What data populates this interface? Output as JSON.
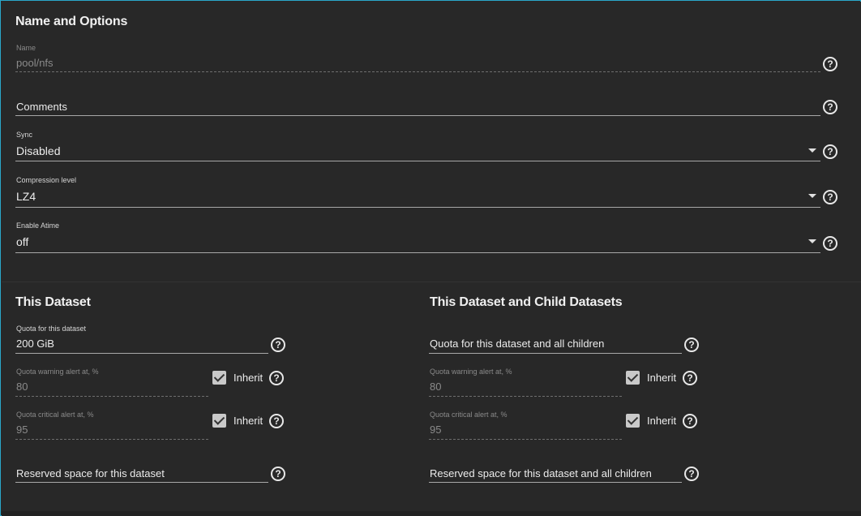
{
  "name_options": {
    "heading": "Name and Options",
    "name": {
      "label": "Name",
      "value": "pool/nfs"
    },
    "comments": {
      "placeholder": "Comments"
    },
    "sync": {
      "label": "Sync",
      "value": "Disabled"
    },
    "compression": {
      "label": "Compression level",
      "value": "LZ4"
    },
    "atime": {
      "label": "Enable Atime",
      "value": "off"
    }
  },
  "this_dataset": {
    "heading": "This Dataset",
    "quota": {
      "label": "Quota for this dataset",
      "value": "200 GiB"
    },
    "warning": {
      "label": "Quota warning alert at, %",
      "value": "80",
      "inherit_label": "Inherit",
      "inherit_checked": true
    },
    "critical": {
      "label": "Quota critical alert at, %",
      "value": "95",
      "inherit_label": "Inherit",
      "inherit_checked": true
    },
    "reserved": {
      "placeholder": "Reserved space for this dataset"
    }
  },
  "child_datasets": {
    "heading": "This Dataset and Child Datasets",
    "quota": {
      "placeholder": "Quota for this dataset and all children"
    },
    "warning": {
      "label": "Quota warning alert at, %",
      "value": "80",
      "inherit_label": "Inherit",
      "inherit_checked": true
    },
    "critical": {
      "label": "Quota critical alert at, %",
      "value": "95",
      "inherit_label": "Inherit",
      "inherit_checked": true
    },
    "reserved": {
      "placeholder": "Reserved space for this dataset and all children"
    }
  },
  "icons": {
    "help": "help-circle-icon",
    "dropdown": "caret-down-icon",
    "check": "checkbox-checked-icon"
  },
  "colors": {
    "background": "#282828",
    "accent_border": "#2aa7c9",
    "text": "#e6e6e6",
    "disabled_text": "#8a8a8a"
  }
}
